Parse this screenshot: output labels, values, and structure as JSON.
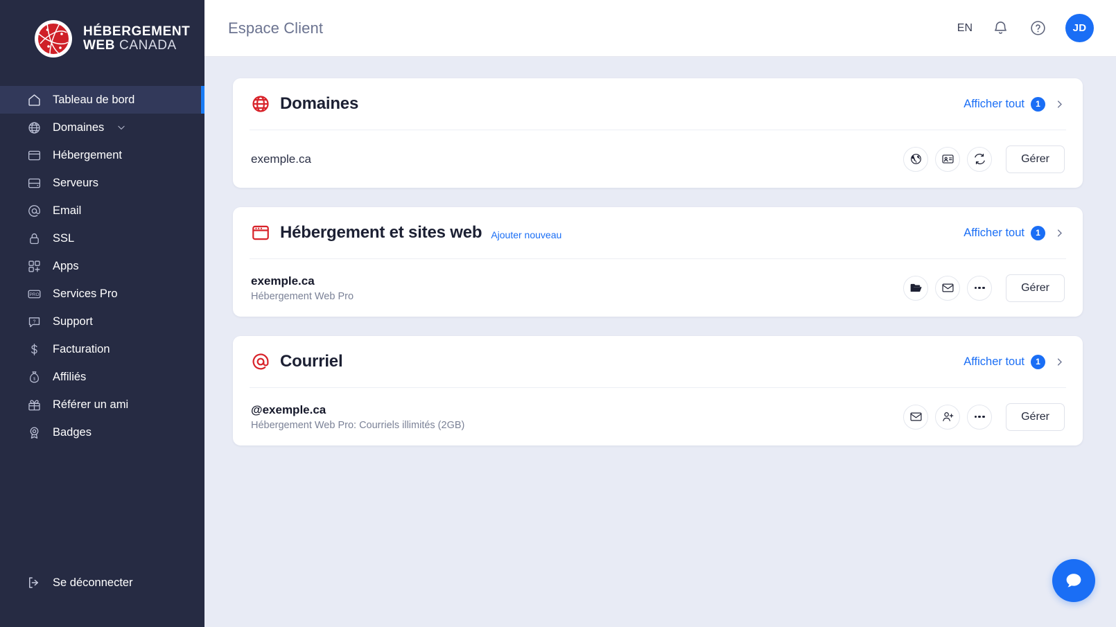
{
  "sidebar": {
    "logo": {
      "line1": "HÉBERGEMENT",
      "line2_bold": "WEB",
      "line2_light": "CANADA",
      "icon": "globe-logo-icon"
    },
    "items": [
      {
        "label": "Tableau de bord",
        "icon": "home-icon",
        "active": true
      },
      {
        "label": "Domaines",
        "icon": "globe-icon",
        "active": false,
        "chevron": "chevron-down-icon"
      },
      {
        "label": "Hébergement",
        "icon": "browser-window-icon",
        "active": false
      },
      {
        "label": "Serveurs",
        "icon": "server-icon",
        "active": false
      },
      {
        "label": "Email",
        "icon": "at-sign-icon",
        "active": false
      },
      {
        "label": "SSL",
        "icon": "lock-icon",
        "active": false
      },
      {
        "label": "Apps",
        "icon": "apps-grid-plus-icon",
        "active": false
      },
      {
        "label": "Services Pro",
        "icon": "pro-badge-icon",
        "active": false
      },
      {
        "label": "Support",
        "icon": "question-chat-icon",
        "active": false
      },
      {
        "label": "Facturation",
        "icon": "dollar-icon",
        "active": false
      },
      {
        "label": "Affiliés",
        "icon": "money-bag-icon",
        "active": false
      },
      {
        "label": "Référer un ami",
        "icon": "gift-icon",
        "active": false
      },
      {
        "label": "Badges",
        "icon": "medal-icon",
        "active": false
      }
    ],
    "logout": {
      "label": "Se déconnecter",
      "icon": "logout-icon"
    }
  },
  "header": {
    "title": "Espace Client",
    "language": "EN",
    "notifications_icon": "bell-icon",
    "help_icon": "help-circle-icon",
    "avatar_initials": "JD"
  },
  "cards": [
    {
      "id": "domains",
      "icon": "globe-icon",
      "title": "Domaines",
      "add_link": "",
      "view_all": {
        "label": "Afficher tout",
        "count": "1",
        "chevron": "chevron-right-icon"
      },
      "rows": [
        {
          "title": "exemple.ca",
          "title_bold": false,
          "subtitle": "",
          "actions": [
            {
              "icon": "globe-filled-icon"
            },
            {
              "icon": "contact-card-icon"
            },
            {
              "icon": "refresh-sync-icon"
            }
          ],
          "manage_label": "Gérer"
        }
      ]
    },
    {
      "id": "hosting",
      "icon": "browser-window-icon",
      "title": "Hébergement et sites web",
      "add_link": "Ajouter nouveau",
      "view_all": {
        "label": "Afficher tout",
        "count": "1",
        "chevron": "chevron-right-icon"
      },
      "rows": [
        {
          "title": "exemple.ca",
          "title_bold": true,
          "subtitle": "Hébergement Web Pro",
          "actions": [
            {
              "icon": "folder-open-icon"
            },
            {
              "icon": "envelope-icon"
            },
            {
              "icon": "ellipsis-icon"
            }
          ],
          "manage_label": "Gérer"
        }
      ]
    },
    {
      "id": "email",
      "icon": "at-sign-icon",
      "title": "Courriel",
      "add_link": "",
      "view_all": {
        "label": "Afficher tout",
        "count": "1",
        "chevron": "chevron-right-icon"
      },
      "rows": [
        {
          "title": "@exemple.ca",
          "title_bold": true,
          "subtitle": "Hébergement Web Pro: Courriels illimités (2GB)",
          "actions": [
            {
              "icon": "envelope-icon"
            },
            {
              "icon": "user-plus-icon"
            },
            {
              "icon": "ellipsis-icon"
            }
          ],
          "manage_label": "Gérer"
        }
      ]
    }
  ],
  "chat_fab": {
    "icon": "chat-bubble-icon"
  },
  "colors": {
    "sidebar_bg": "#262b43",
    "accent_blue": "#1a6ef5",
    "brand_red": "#d8232a",
    "page_bg": "#e8ebf5"
  }
}
